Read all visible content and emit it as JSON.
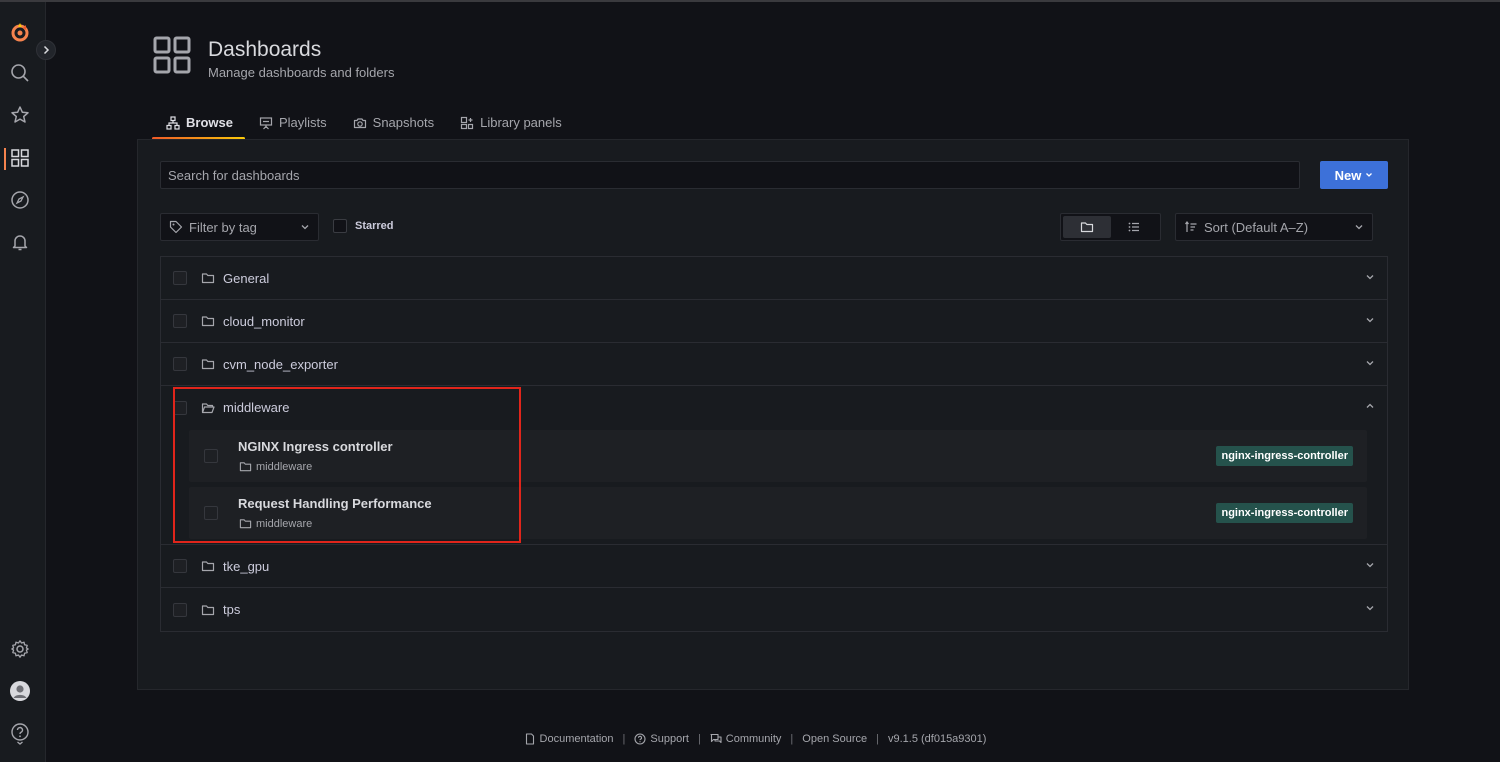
{
  "header": {
    "title": "Dashboards",
    "subtitle": "Manage dashboards and folders"
  },
  "tabs": [
    {
      "label": "Browse",
      "icon": "sitemap-icon",
      "active": true
    },
    {
      "label": "Playlists",
      "icon": "presentation-icon",
      "active": false
    },
    {
      "label": "Snapshots",
      "icon": "camera-icon",
      "active": false
    },
    {
      "label": "Library panels",
      "icon": "library-panel-icon",
      "active": false
    }
  ],
  "search": {
    "placeholder": "Search for dashboards",
    "value": ""
  },
  "new_button": {
    "label": "New"
  },
  "filter_tag": {
    "placeholder": "Filter by tag"
  },
  "starred": {
    "label": "Starred",
    "checked": false
  },
  "view_mode": {
    "selected": "folders"
  },
  "sort": {
    "label": "Sort (Default A–Z)"
  },
  "folders": [
    {
      "name": "General",
      "expanded": false
    },
    {
      "name": "cloud_monitor",
      "expanded": false
    },
    {
      "name": "cvm_node_exporter",
      "expanded": false
    },
    {
      "name": "middleware",
      "expanded": true,
      "dashboards": [
        {
          "title": "NGINX Ingress controller",
          "folder": "middleware",
          "tag": "nginx-ingress-controller"
        },
        {
          "title": "Request Handling Performance",
          "folder": "middleware",
          "tag": "nginx-ingress-controller"
        }
      ]
    },
    {
      "name": "tke_gpu",
      "expanded": false
    },
    {
      "name": "tps",
      "expanded": false
    }
  ],
  "footer": {
    "documentation": "Documentation",
    "support": "Support",
    "community": "Community",
    "open_source": "Open Source",
    "version": "v9.1.5 (df015a9301)"
  },
  "colors": {
    "accent": "#3d71d9",
    "active_tab_gradient_start": "#f05a28",
    "active_tab_gradient_end": "#fbca0a",
    "tag_bg": "#25524c",
    "highlight_box": "#e0251b"
  }
}
